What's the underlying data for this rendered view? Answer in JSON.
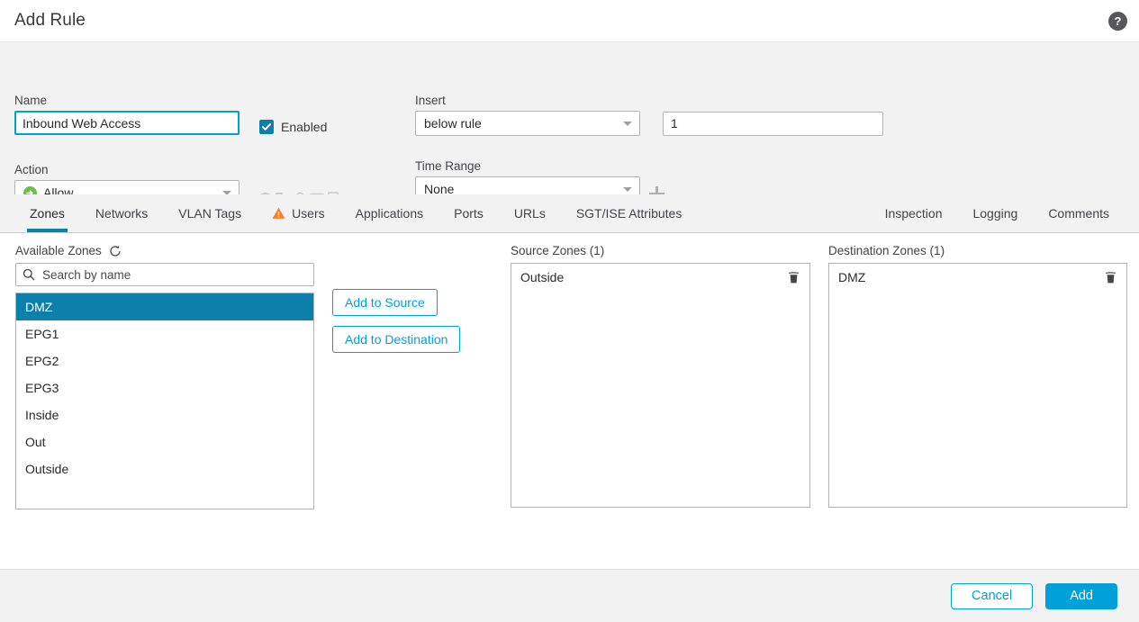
{
  "window": {
    "title": "Add Rule",
    "help_icon": "help-circle-icon",
    "help_glyph": "?"
  },
  "form": {
    "name_label": "Name",
    "name_value": "Inbound Web Access",
    "name_placeholder": "",
    "enabled_label": "Enabled",
    "enabled_checked": true,
    "action_label": "Action",
    "action_value": "Allow",
    "action_icon": "allow-arrow-icon",
    "insert_label": "Insert",
    "insert_value": "below rule",
    "insert_number": "1",
    "time_range_label": "Time Range",
    "time_range_value": "None",
    "add_time_range_icon": "plus-icon",
    "inspection_icons": [
      "shield-icon",
      "file-policy-icon",
      "identity-search-icon",
      "url-filtering-icon",
      "logging-icon"
    ]
  },
  "tabs": {
    "left": [
      {
        "label": "Zones",
        "active": true,
        "warning": false
      },
      {
        "label": "Networks",
        "active": false,
        "warning": false
      },
      {
        "label": "VLAN Tags",
        "active": false,
        "warning": false
      },
      {
        "label": "Users",
        "active": false,
        "warning": true
      },
      {
        "label": "Applications",
        "active": false,
        "warning": false
      },
      {
        "label": "Ports",
        "active": false,
        "warning": false
      },
      {
        "label": "URLs",
        "active": false,
        "warning": false
      },
      {
        "label": "SGT/ISE Attributes",
        "active": false,
        "warning": false
      }
    ],
    "right": [
      {
        "label": "Inspection",
        "active": false,
        "warning": false
      },
      {
        "label": "Logging",
        "active": false,
        "warning": false
      },
      {
        "label": "Comments",
        "active": false,
        "warning": false
      }
    ]
  },
  "available": {
    "title": "Available Zones",
    "refresh_icon": "refresh-icon",
    "search_icon": "search-icon",
    "search_value": "",
    "search_placeholder": "Search by name",
    "items": [
      {
        "label": "DMZ",
        "selected": true
      },
      {
        "label": "EPG1",
        "selected": false
      },
      {
        "label": "EPG2",
        "selected": false
      },
      {
        "label": "EPG3",
        "selected": false
      },
      {
        "label": "Inside",
        "selected": false
      },
      {
        "label": "Out",
        "selected": false
      },
      {
        "label": "Outside",
        "selected": false
      }
    ]
  },
  "actions": {
    "add_to_source": "Add to Source",
    "add_to_destination": "Add to Destination"
  },
  "source": {
    "title": "Source Zones (1)",
    "items": [
      {
        "label": "Outside",
        "delete_icon": "trash-icon"
      }
    ]
  },
  "destination": {
    "title": "Destination Zones (1)",
    "items": [
      {
        "label": "DMZ",
        "delete_icon": "trash-icon"
      }
    ]
  },
  "footer": {
    "cancel_label": "Cancel",
    "add_label": "Add"
  },
  "colors": {
    "accent": "#00a0d9",
    "selection": "#0d7fab",
    "allow_green": "#6cc04a",
    "warning_orange": "#f58025",
    "panel_bg": "#f2f2f2"
  }
}
